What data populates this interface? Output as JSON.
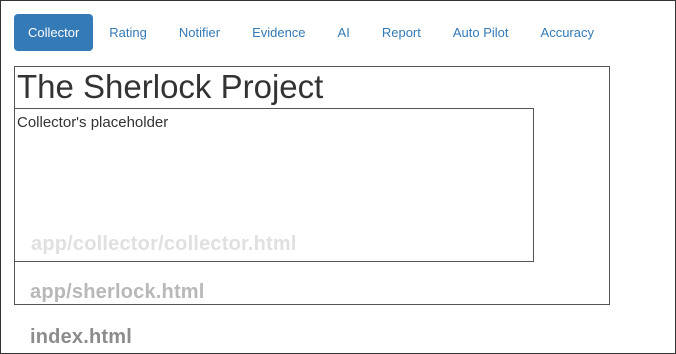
{
  "nav": {
    "tabs": [
      {
        "label": "Collector",
        "active": true
      },
      {
        "label": "Rating",
        "active": false
      },
      {
        "label": "Notifier",
        "active": false
      },
      {
        "label": "Evidence",
        "active": false
      },
      {
        "label": "AI",
        "active": false
      },
      {
        "label": "Report",
        "active": false
      },
      {
        "label": "Auto Pilot",
        "active": false
      },
      {
        "label": "Accuracy",
        "active": false
      }
    ]
  },
  "main": {
    "title": "The Sherlock Project",
    "placeholder": "Collector's placeholder"
  },
  "file_labels": {
    "collector": "app/collector/collector.html",
    "sherlock": "app/sherlock.html",
    "index": "index.html"
  },
  "colors": {
    "accent": "#337ab7",
    "tab_active_text": "#ffffff",
    "text": "#333333"
  }
}
